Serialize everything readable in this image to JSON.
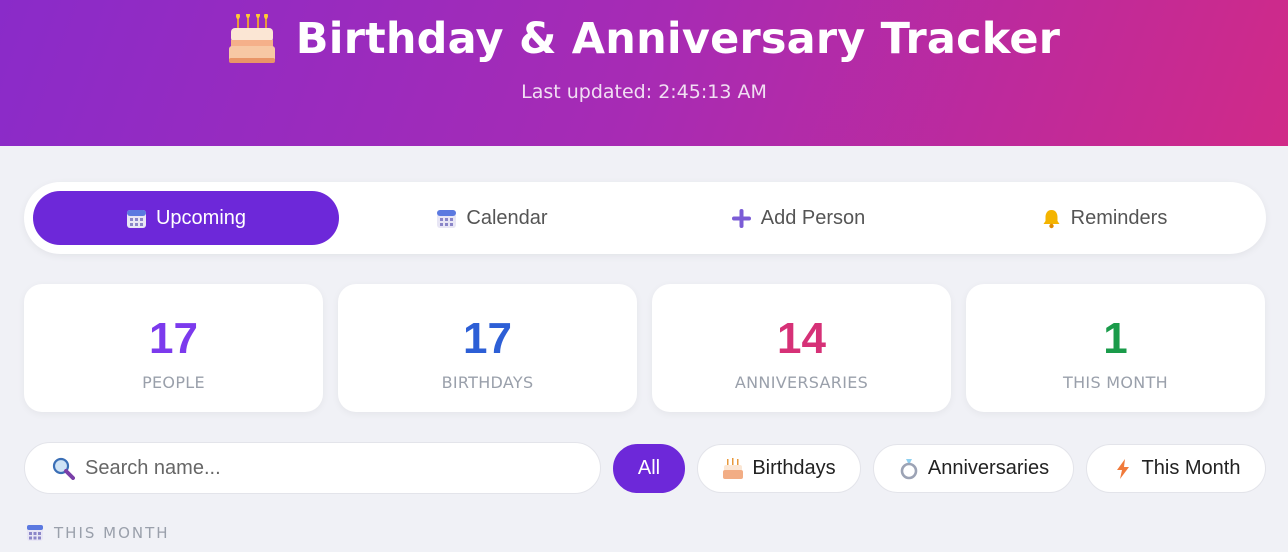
{
  "header": {
    "icon": "birthday-cake-icon",
    "title": "Birthday & Anniversary Tracker",
    "last_updated": "Last updated: 2:45:13 AM"
  },
  "tabs": [
    {
      "label": "Upcoming",
      "icon": "calendar-icon",
      "active": true
    },
    {
      "label": "Calendar",
      "icon": "calendar-icon",
      "active": false
    },
    {
      "label": "Add Person",
      "icon": "plus-icon",
      "active": false
    },
    {
      "label": "Reminders",
      "icon": "bell-icon",
      "active": false
    }
  ],
  "stats": [
    {
      "value": "17",
      "label": "PEOPLE",
      "color": "#7c3aed"
    },
    {
      "value": "17",
      "label": "BIRTHDAYS",
      "color": "#2d5fd6"
    },
    {
      "value": "14",
      "label": "ANNIVERSARIES",
      "color": "#d63177"
    },
    {
      "value": "1",
      "label": "THIS MONTH",
      "color": "#1a9b4a"
    }
  ],
  "search": {
    "icon": "magnifier-icon",
    "placeholder": "Search name...",
    "value": ""
  },
  "filters": [
    {
      "label": "All",
      "icon": "",
      "active": true
    },
    {
      "label": "Birthdays",
      "icon": "birthday-cake-icon",
      "active": false
    },
    {
      "label": "Anniversaries",
      "icon": "ring-icon",
      "active": false
    },
    {
      "label": "This Month",
      "icon": "lightning-icon",
      "active": false
    }
  ],
  "section": {
    "icon": "calendar-icon",
    "title": "THIS MONTH"
  },
  "colors": {
    "accent": "#6d28d9",
    "header_gradient_start": "#8a2bc9",
    "header_gradient_end": "#d02a88"
  }
}
